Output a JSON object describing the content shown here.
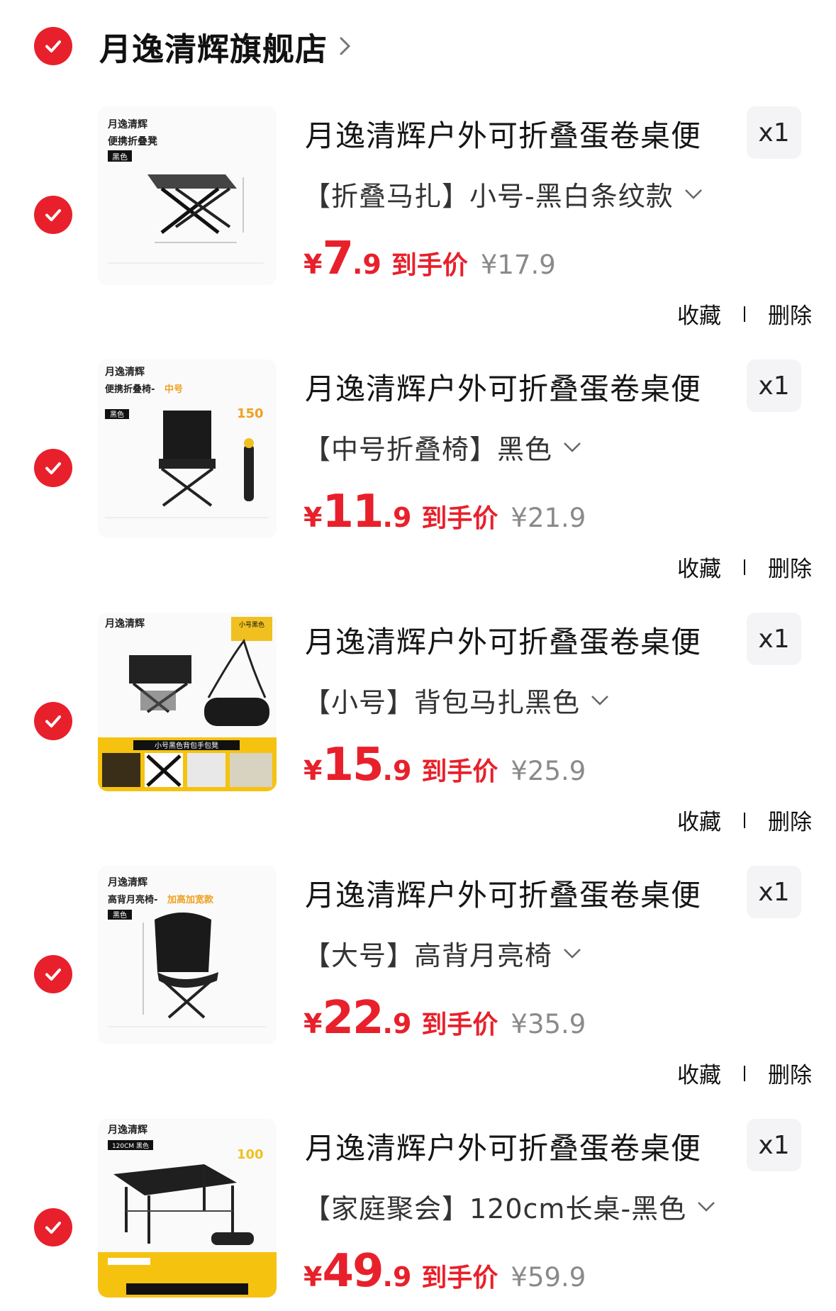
{
  "shop": {
    "name": "月逸清辉旗舰店"
  },
  "colors": {
    "accent": "#e8202b",
    "muted": "#8a8a8a"
  },
  "icons": {
    "check": "check-icon",
    "arrow": "chevron-right-icon",
    "spec": "chevron-down-icon"
  },
  "items": [
    {
      "title": "月逸清辉户外可折叠蛋卷桌便",
      "quantity": "x1",
      "spec": "【折叠马扎】小号-黑白条纹款",
      "yen": "¥",
      "price_int": "7",
      "price_dec": ".9",
      "price_tag": "到手价",
      "orig_price": "¥17.9",
      "favorite_label": "收藏",
      "delete_label": "删除",
      "thumb": {
        "brand": "月逸清辉",
        "line1": "便携折叠凳",
        "line2": "",
        "color_tag": "黑色",
        "side": ""
      }
    },
    {
      "title": "月逸清辉户外可折叠蛋卷桌便",
      "quantity": "x1",
      "spec": "【中号折叠椅】黑色",
      "yen": "¥",
      "price_int": "11",
      "price_dec": ".9",
      "price_tag": "到手价",
      "orig_price": "¥21.9",
      "favorite_label": "收藏",
      "delete_label": "删除",
      "thumb": {
        "brand": "月逸清辉",
        "line1": "便携折叠椅-",
        "line2": "中号",
        "color_tag": "黑色",
        "side": "150"
      }
    },
    {
      "title": "月逸清辉户外可折叠蛋卷桌便",
      "quantity": "x1",
      "spec": "【小号】背包马扎黑色",
      "yen": "¥",
      "price_int": "15",
      "price_dec": ".9",
      "price_tag": "到手价",
      "orig_price": "¥25.9",
      "favorite_label": "收藏",
      "delete_label": "删除",
      "thumb": {
        "brand": "月逸清辉",
        "line1": "",
        "line2": "",
        "color_tag": "小号黑色",
        "side": "小号黑色背包手包凳"
      }
    },
    {
      "title": "月逸清辉户外可折叠蛋卷桌便",
      "quantity": "x1",
      "spec": "【大号】高背月亮椅",
      "yen": "¥",
      "price_int": "22",
      "price_dec": ".9",
      "price_tag": "到手价",
      "orig_price": "¥35.9",
      "favorite_label": "收藏",
      "delete_label": "删除",
      "thumb": {
        "brand": "月逸清辉",
        "line1": "高背月亮椅-",
        "line2": "加高加宽款",
        "color_tag": "黑色",
        "side": ""
      }
    },
    {
      "title": "月逸清辉户外可折叠蛋卷桌便",
      "quantity": "x1",
      "spec": "【家庭聚会】120cm长桌-黑色",
      "yen": "¥",
      "price_int": "49",
      "price_dec": ".9",
      "price_tag": "到手价",
      "orig_price": "¥59.9",
      "favorite_label": "收藏",
      "delete_label": "删除",
      "thumb": {
        "brand": "月逸清辉",
        "line1": "",
        "line2": "",
        "color_tag": "120CM 黑色",
        "side": "100"
      }
    }
  ]
}
